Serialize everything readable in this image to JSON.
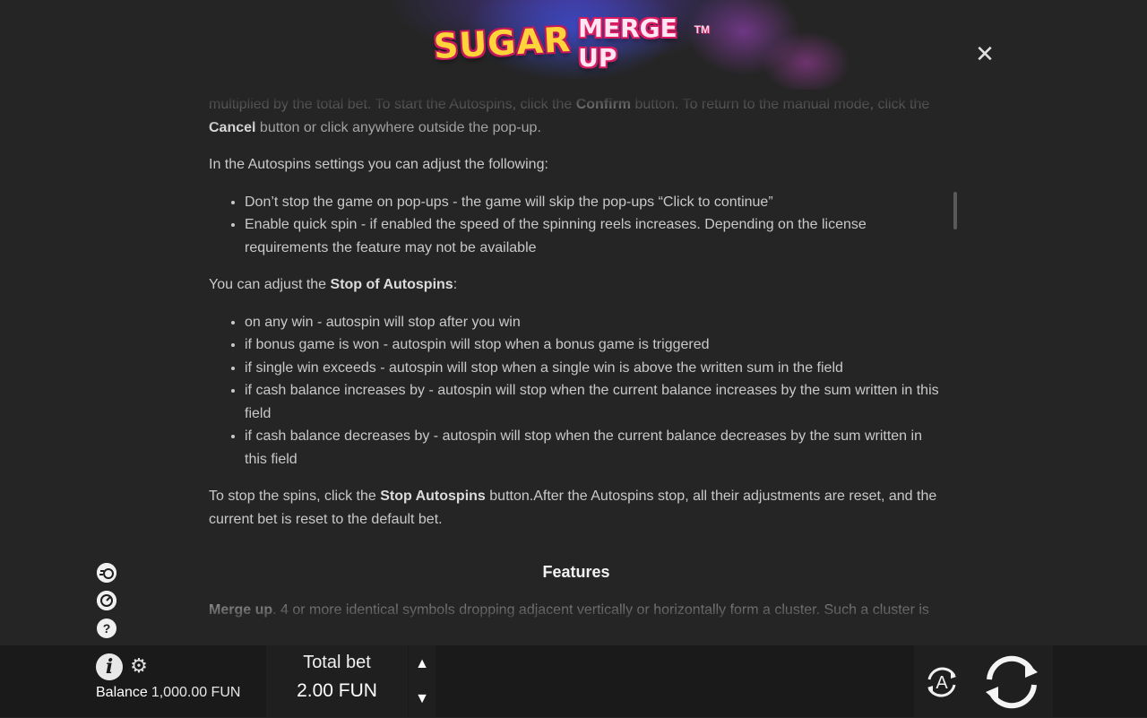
{
  "game": {
    "logo_text_sugar": "SUGAR",
    "logo_text_merge": "MERGE UP",
    "logo_tm": "TM",
    "close_icon": "close-icon"
  },
  "rules": {
    "p1_a": "multiplied by the total bet. To start the Autospins, click the ",
    "p1_b": "Confirm",
    "p1_c": " button. To return to the manual mode, click the ",
    "p1_d": "Cancel",
    "p1_e": " button or click anywhere outside the pop-up.",
    "p2": "In the Autospins settings you can adjust the following:",
    "list1": [
      "Don’t stop the game on pop-ups - the game will skip the pop-ups “Click to continue”",
      "Enable quick spin - if enabled the speed of the spinning reels increases. Depending on the license requirements the feature may not be available"
    ],
    "p3_a": "You can adjust the ",
    "p3_b": "Stop of Autospins",
    "p3_c": ":",
    "list2": [
      "on any win - autospin will stop after you win",
      "if bonus game is won - autospin will stop when a bonus game is triggered",
      "if single win exceeds - autospin will stop when a single win is above the written sum in the field",
      "if cash balance increases by - autospin will stop when the current balance increases by the sum written in this field",
      "if cash balance decreases by - autospin will stop when the current balance decreases by the sum written in this field"
    ],
    "p4_a": "To stop the spins, click the ",
    "p4_b": "Stop Autospins",
    "p4_c": " button.After the Autospins stop, all their adjustments are reset, and the current bet is reset to the default bet.",
    "features_heading": "Features",
    "p5_a": "Merge up",
    "p5_b": ". 4 or more identical symbols dropping adjacent vertically or horizontally form a cluster. Such a cluster is"
  },
  "side_icons": {
    "icon1": "coin-speed-icon",
    "icon2": "autoplay-circle-icon",
    "icon3": "?"
  },
  "bottom": {
    "info_label": "i",
    "balance_label": "Balance",
    "balance_value": "1,000.00 FUN",
    "total_bet_label": "Total bet",
    "total_bet_value": "2.00 FUN",
    "auto_label": "A"
  },
  "colors": {
    "background": "#252525",
    "bottom_bar": "#1a1a1a",
    "text": "#c9c9c9",
    "heading": "#f2f2f2",
    "logo_yellow": "#ffd43a",
    "logo_pink": "#d81b60"
  }
}
